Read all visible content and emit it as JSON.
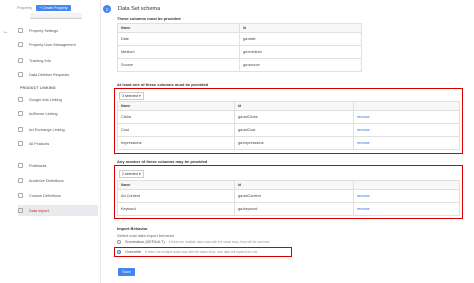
{
  "sidebar": {
    "property_label": "Property",
    "create_button": "+ Create Property",
    "items": [
      {
        "label": "Property Settings"
      },
      {
        "label": "Property User Management"
      },
      {
        "label": "Tracking Info"
      },
      {
        "label": "Data Deletion Requests"
      }
    ],
    "product_linking_label": "PRODUCT LINKING",
    "linking_items": [
      {
        "label": "Google Ads Linking"
      },
      {
        "label": "AdSense Linking"
      },
      {
        "label": "Ad Exchange Linking"
      },
      {
        "label": "All Products"
      }
    ],
    "other_items": [
      {
        "label": "Postbacks"
      },
      {
        "label": "Audience Definitions"
      },
      {
        "label": "Custom Definitions"
      },
      {
        "label": "Data Import"
      }
    ]
  },
  "schema": {
    "step": "1",
    "title": "Data Set schema",
    "required_caption": "These columns must be provided",
    "headers": [
      "Name",
      "Id"
    ],
    "required_rows": [
      [
        "Date",
        "ga:date"
      ],
      [
        "Medium",
        "ga:medium"
      ],
      [
        "Source",
        "ga:source"
      ]
    ],
    "atleast_caption": "At least one of these columns must be provided",
    "atleast_selected": "3 selected",
    "atleast_rows": [
      [
        "Clicks",
        "ga:adClicks",
        "remove"
      ],
      [
        "Cost",
        "ga:adCost",
        "remove"
      ],
      [
        "Impressions",
        "ga:impressions",
        "remove"
      ]
    ],
    "any_caption": "Any number of these columns may be provided",
    "any_selected": "2 selected",
    "any_rows": [
      [
        "Ad Content",
        "ga:adContent",
        "remove"
      ],
      [
        "Keyword",
        "ga:keyword",
        "remove"
      ]
    ],
    "import_behavior_title": "Import Behavior",
    "import_behavior_sub": "Select cost data import behavior",
    "option_summation": "Summation (DEFAULT)",
    "option_summation_hint": "If there are multiple data rows with the same keys, they will be summed.",
    "option_overwrite": "Overwrite",
    "option_overwrite_hint": "If there are multiple data rows with the same keys, new data will replace the old.",
    "save_label": "Save"
  }
}
